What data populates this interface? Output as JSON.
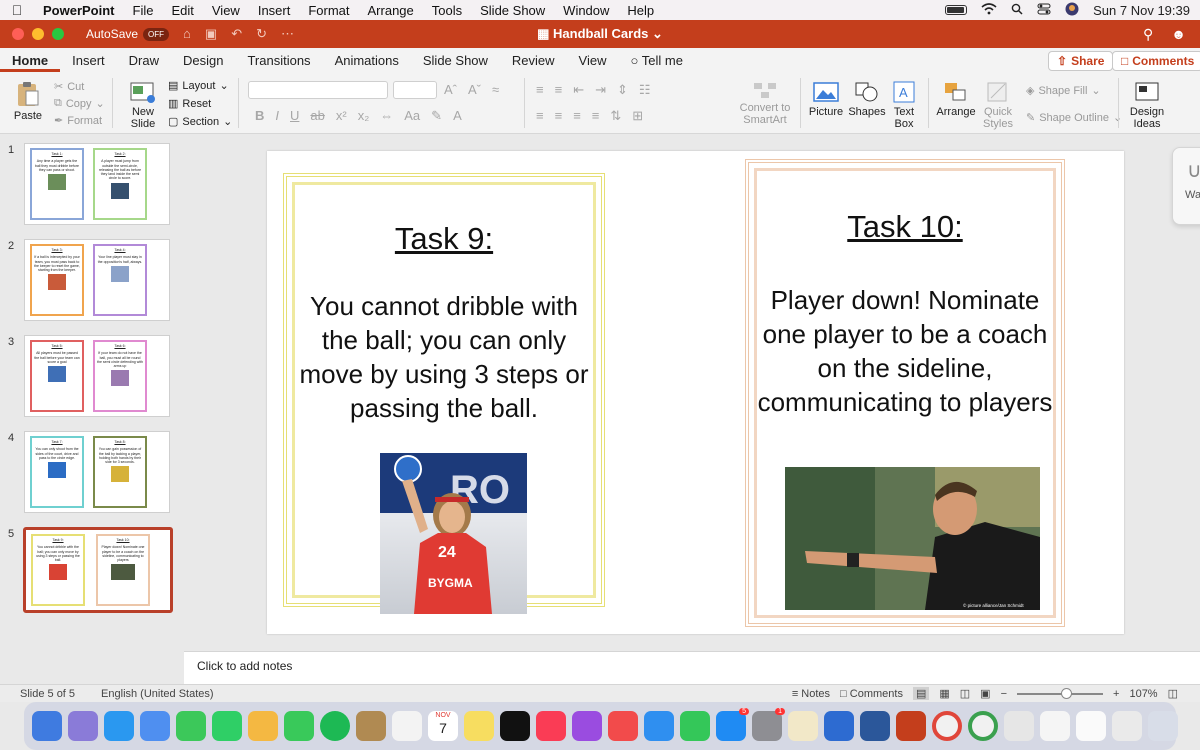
{
  "menubar": {
    "app": "PowerPoint",
    "items": [
      "File",
      "Edit",
      "View",
      "Insert",
      "Format",
      "Arrange",
      "Tools",
      "Slide Show",
      "Window",
      "Help"
    ],
    "datetime": "Sun 7 Nov  19:39"
  },
  "titlebar": {
    "autosave": "AutoSave",
    "toggle": "OFF",
    "doc_title": "Handball Cards"
  },
  "tabs": [
    "Home",
    "Insert",
    "Draw",
    "Design",
    "Transitions",
    "Animations",
    "Slide Show",
    "Review",
    "View"
  ],
  "tell_me": "Tell me",
  "share": "Share",
  "comments_button": "Comments",
  "ribbon": {
    "paste": "Paste",
    "cut": "Cut",
    "copy": "Copy",
    "format": "Format",
    "new_slide_1": "New",
    "new_slide_2": "Slide",
    "layout": "Layout",
    "reset": "Reset",
    "section": "Section",
    "convert_1": "Convert to",
    "convert_2": "SmartArt",
    "picture": "Picture",
    "shapes": "Shapes",
    "textbox_1": "Text",
    "textbox_2": "Box",
    "arrange": "Arrange",
    "quick_1": "Quick",
    "quick_2": "Styles",
    "shape_fill": "Shape Fill",
    "shape_outline": "Shape Outline",
    "design_1": "Design",
    "design_2": "Ideas"
  },
  "thumbnails": [
    {
      "num": "1",
      "a_title": "Task 1:",
      "a_text": "Any time a player gets the ball they must dribble before they can pass or shoot.",
      "b_title": "Task 2:",
      "b_text": "A player must jump from outside the semi-circle, releasing the ball as before they land inside the semi circle to score."
    },
    {
      "num": "2",
      "a_title": "Task 3:",
      "a_text": "If a ball is intercepted by your team, you must pass back to the keeper to reset the game, starting from the keeper.",
      "b_title": "Task 4:",
      "b_text": "Your line player must stay in the opposition's half, always."
    },
    {
      "num": "3",
      "a_title": "Task 5:",
      "a_text": "All players must be passed the ball before your team can score a goal",
      "b_title": "Task 6:",
      "b_text": "If your team do not have the ball, you must all be round the semi circle defending with arms up"
    },
    {
      "num": "4",
      "a_title": "Task 7:",
      "a_text": "You can only shoot from the sides of the court, drive and pass to the circle edge.",
      "b_title": "Task 8:",
      "b_text": "You can gain possession of the ball by tacking a player, holding both hands by their side for 3 seconds."
    },
    {
      "num": "5",
      "a_title": "Task 9:",
      "a_text": "You cannot dribble with the ball; you can only move by using 3 steps or passing the ball.",
      "b_title": "Task 10:",
      "b_text": "Player down! Nominate one player to be a coach on the sideline, communicating to players"
    }
  ],
  "slide": {
    "card9_title": "Task 9:",
    "card9_text": "You cannot dribble with the ball; you can only move by using 3 steps or passing the ball.",
    "card10_title": "Task 10:",
    "card10_text": "Player down! Nominate one player to be a coach on the sideline, communicating to players",
    "photo9_jersey": "24",
    "photo9_sponsor": "BYGMA",
    "photo10_credit": "© picture alliance/Jan Schmidt"
  },
  "sidepanel_text": "Wa",
  "notes_placeholder": "Click to add notes",
  "status": {
    "slide": "Slide 5 of 5",
    "language": "English (United States)",
    "notes": "Notes",
    "comments": "Comments",
    "zoom": "107%"
  },
  "dock": {
    "calendar_month": "NOV",
    "calendar_day": "7",
    "badge_appstore": "5",
    "badge_settings": "1"
  },
  "colors": {
    "accent": "#c43e1c",
    "card9_border": "#e6df74",
    "card10_border": "#ecc6a9"
  }
}
